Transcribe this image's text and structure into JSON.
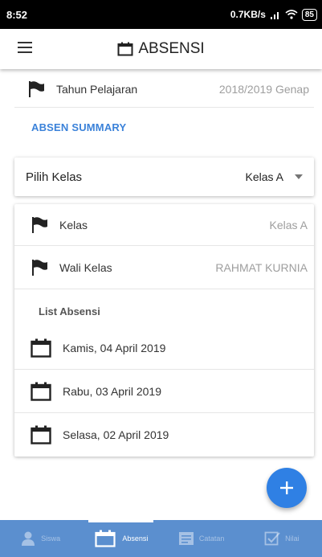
{
  "status_bar": {
    "time": "8:52",
    "network_speed": "0.7KB/s",
    "battery": "85"
  },
  "app_bar": {
    "title": "ABSENSI",
    "menu_icon": "hamburger-icon",
    "title_icon": "calendar-icon"
  },
  "tahun": {
    "label": "Tahun Pelajaran",
    "value": "2018/2019 Genap",
    "icon": "flag-icon"
  },
  "summary_link": "ABSEN SUMMARY",
  "pilih": {
    "label": "Pilih Kelas",
    "selected": "Kelas A"
  },
  "info": {
    "kelas_label": "Kelas",
    "kelas_value": "Kelas A",
    "wali_label": "Wali Kelas",
    "wali_value": "RAHMAT KURNIA"
  },
  "list": {
    "header": "List Absensi",
    "items": [
      {
        "date": "Kamis, 04 April 2019"
      },
      {
        "date": "Rabu, 03 April 2019"
      },
      {
        "date": "Selasa, 02 April 2019"
      }
    ]
  },
  "fab": {
    "icon": "plus-icon"
  },
  "bottom_nav": {
    "items": [
      {
        "label": "Siswa",
        "icon": "person-icon",
        "active": false
      },
      {
        "label": "Absensi",
        "icon": "calendar-icon",
        "active": true
      },
      {
        "label": "Catatan",
        "icon": "notes-icon",
        "active": false
      },
      {
        "label": "Nilai",
        "icon": "checkbox-icon",
        "active": false
      }
    ]
  },
  "colors": {
    "accent": "#2f80e4",
    "link": "#3b82d9",
    "nav_bg": "#5b8fcf",
    "status_bar": "#000000"
  }
}
